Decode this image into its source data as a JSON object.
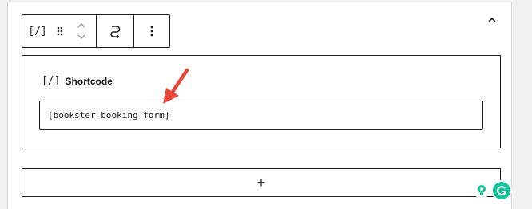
{
  "toolbar": {
    "block_icon_label": "[/]",
    "block_type_title": "Shortcode",
    "drag_handle_label": "Drag",
    "move_up_label": "Move up",
    "move_down_label": "Move down",
    "transform_label": "Transform",
    "options_label": "Options"
  },
  "block": {
    "label_icon": "[/]",
    "label": "Shortcode",
    "shortcode_value": "[bookster_booking_form]"
  },
  "appender": {
    "symbol": "+"
  },
  "icons": {
    "collapse": "chevron-up-icon",
    "drag": "drag-handle-icon",
    "mover": "chevron-updown-icon",
    "transform": "transform-icon",
    "options": "kebab-menu-icon",
    "annotation": "red-arrow-icon",
    "bulb": "lightbulb-icon",
    "grammarly": "grammarly-icon"
  },
  "colors": {
    "border": "#1e1e1e",
    "annotation": "#e8463a",
    "grammarly": "#15c39a",
    "bulb": "#15c39a"
  }
}
